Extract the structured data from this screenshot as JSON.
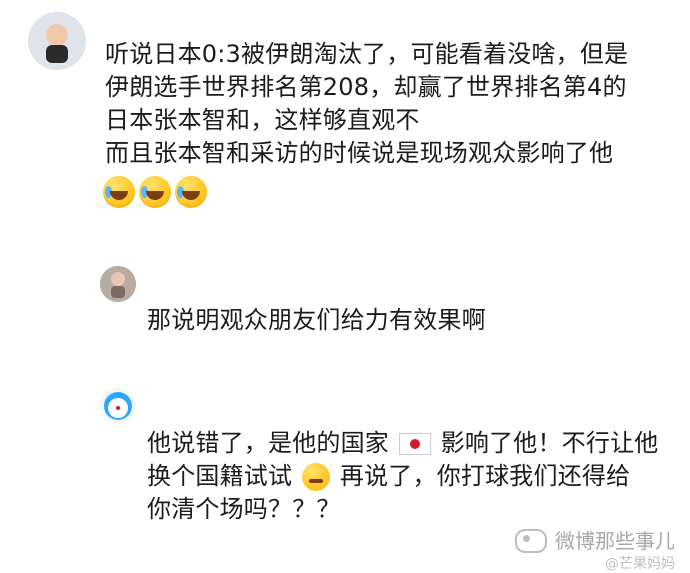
{
  "comments": [
    {
      "avatar_icon": "user-avatar-icon",
      "lines": [
        "听说日本0:3被伊朗淘汰了，可能看着没啥，但是",
        "伊朗选手世界排名第208，却赢了世界排名第4的",
        "日本张本智和，这样够直观不",
        "而且张本智和采访的时候说是现场观众影响了他"
      ],
      "emojis": [
        "laughing-crying-emoji",
        "laughing-crying-emoji",
        "laughing-crying-emoji"
      ]
    },
    {
      "avatar_icon": "user-avatar-icon",
      "lines": [
        "那说明观众朋友们给力有效果啊"
      ]
    },
    {
      "avatar_icon": "doraemon-avatar-icon",
      "lines": [
        {
          "before": "他说错了，是他的国家",
          "inline_icon": "japan-flag-icon",
          "after": "影响了他！不行让他"
        },
        {
          "before": "换个国籍试试",
          "inline_icon": "thinking-face-icon",
          "after": "再说了，你打球我们还得给"
        },
        "你清个场吗？？？"
      ]
    }
  ],
  "watermark": {
    "text": "微博那些事儿",
    "sub": "@芒果妈妈",
    "icon": "wechat-style-watermark-icon"
  }
}
